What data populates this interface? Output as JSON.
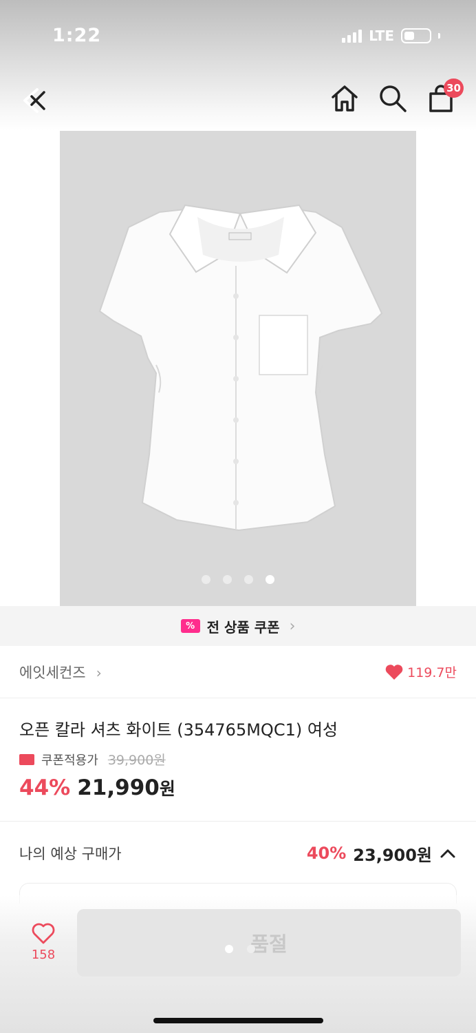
{
  "status_bar": {
    "time": "1:22",
    "network": "LTE"
  },
  "header": {
    "cart_count": "30"
  },
  "gallery": {
    "dot_count": 4,
    "active_index": 3
  },
  "coupon_banner": {
    "label": "전 상품 쿠폰",
    "icon_text": "%"
  },
  "brand": {
    "name": "에잇세컨즈",
    "likes": "119.7만"
  },
  "product": {
    "title": "오픈 칼라 셔츠 화이트 (354765MQC1) 여성",
    "coupon_label": "쿠폰적용가",
    "original_price": "39,900원",
    "discount": "44%",
    "price_number": "21,990",
    "price_unit": "원"
  },
  "estimate": {
    "label": "나의 예상 구매가",
    "discount": "40%",
    "price": "23,900원"
  },
  "bottom": {
    "wish_count": "158",
    "button_label": "품절"
  },
  "colors": {
    "accent": "#ec4a5c",
    "coupon_pink": "#ff2d8d"
  }
}
